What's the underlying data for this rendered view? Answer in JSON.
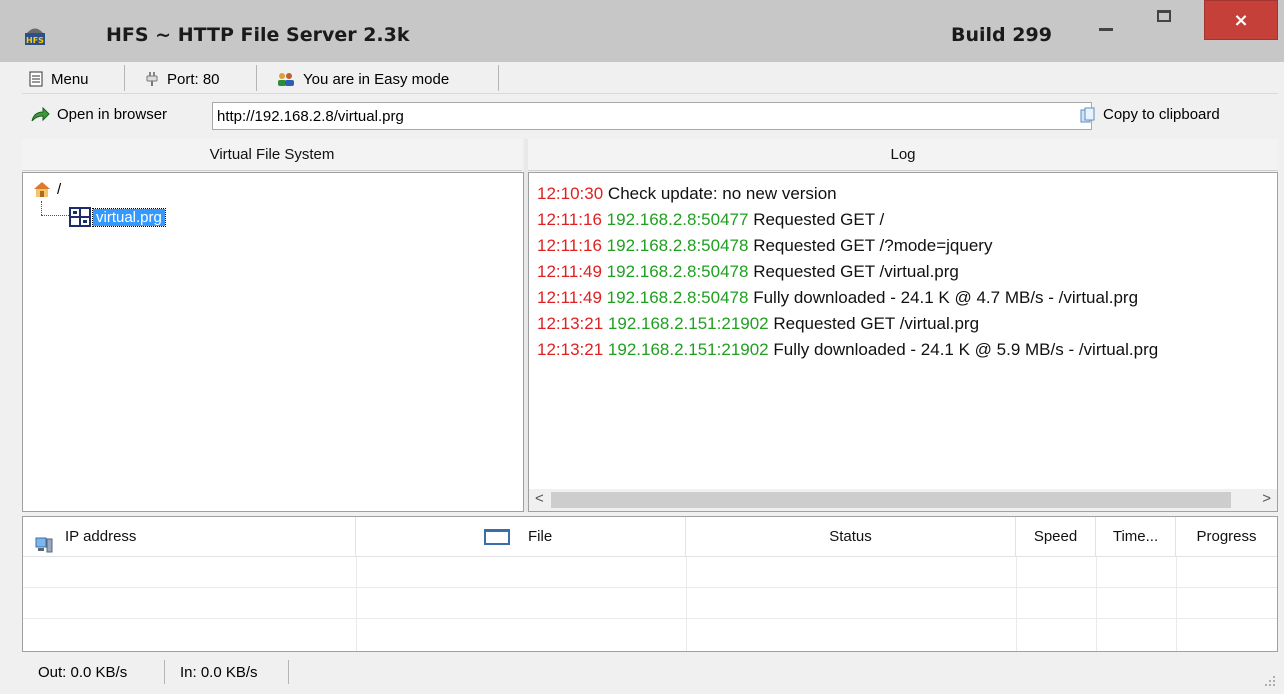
{
  "window": {
    "title": "HFS ~ HTTP File Server 2.3k",
    "build": "Build 299",
    "close_glyph": "×"
  },
  "toolbar": {
    "menu_label": "Menu",
    "port_label": "Port: 80",
    "mode_label": "You are in Easy mode"
  },
  "addressbar": {
    "open_label": "Open in browser",
    "url": "http://192.168.2.8/virtual.prg",
    "copy_label": "Copy to clipboard"
  },
  "vfs": {
    "header": "Virtual File System",
    "root": "/",
    "child": "virtual.prg"
  },
  "log": {
    "header": "Log",
    "entries": [
      {
        "time": "12:10:30",
        "ip": "",
        "msg": "Check update: no new version"
      },
      {
        "time": "12:11:16",
        "ip": "192.168.2.8:50477",
        "msg": "Requested GET /"
      },
      {
        "time": "12:11:16",
        "ip": "192.168.2.8:50478",
        "msg": "Requested GET /?mode=jquery"
      },
      {
        "time": "12:11:49",
        "ip": "192.168.2.8:50478",
        "msg": "Requested GET /virtual.prg"
      },
      {
        "time": "12:11:49",
        "ip": "192.168.2.8:50478",
        "msg": "Fully downloaded - 24.1 K @ 4.7 MB/s - /virtual.prg"
      },
      {
        "time": "12:13:21",
        "ip": "192.168.2.151:21902",
        "msg": "Requested GET /virtual.prg"
      },
      {
        "time": "12:13:21",
        "ip": "192.168.2.151:21902",
        "msg": "Fully downloaded - 24.1 K @ 5.9 MB/s - /virtual.prg"
      }
    ],
    "scroll_left": "<",
    "scroll_right": ">"
  },
  "connections": {
    "columns": [
      "IP address",
      "File",
      "Status",
      "Speed",
      "Time...",
      "Progress"
    ]
  },
  "statusbar": {
    "out": "Out: 0.0 KB/s",
    "in": "In: 0.0 KB/s"
  },
  "colors": {
    "log_time": "#e02020",
    "log_ip": "#1fa01f",
    "selection": "#3399ff",
    "close_button": "#c6403a"
  }
}
